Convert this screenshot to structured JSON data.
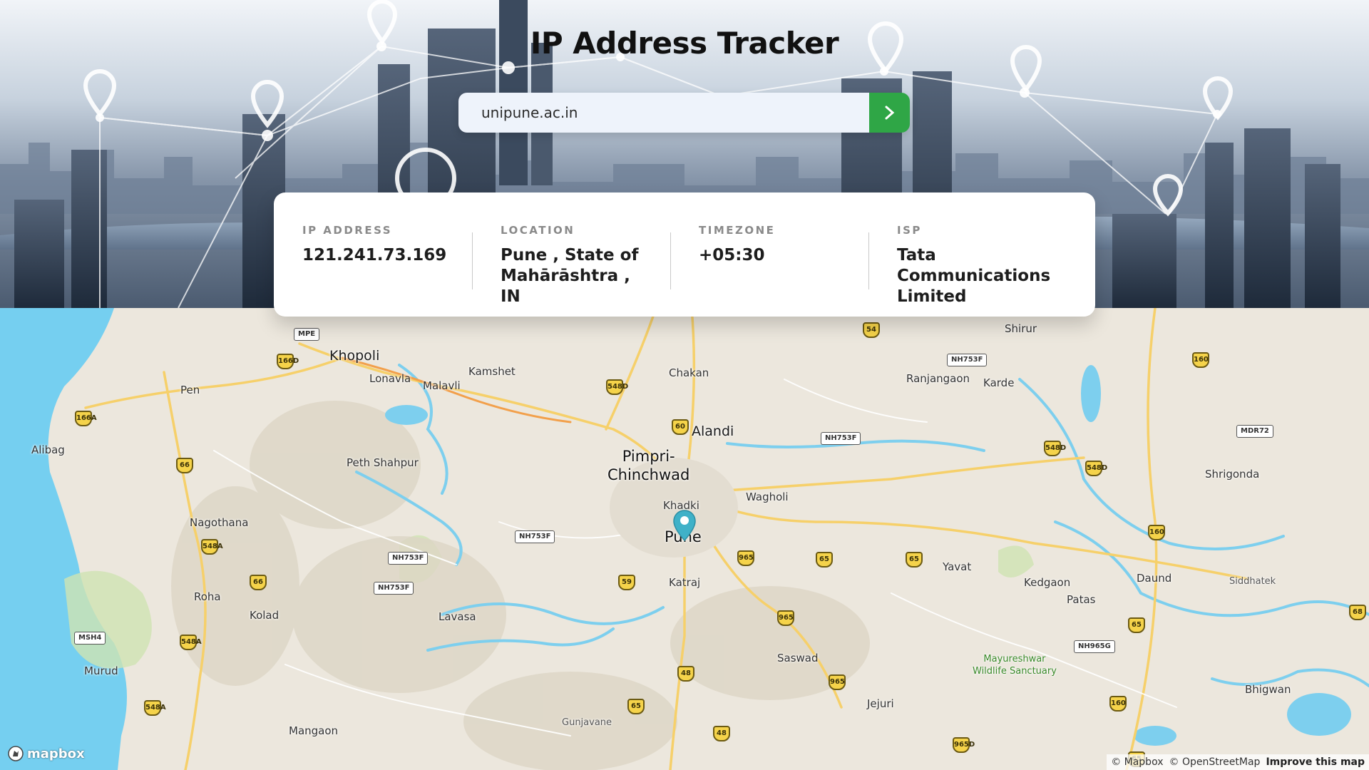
{
  "header": {
    "title": "IP Address Tracker",
    "search": {
      "value": "unipune.ac.in"
    }
  },
  "info": {
    "ip": {
      "label": "IP ADDRESS",
      "value": "121.241.73.169"
    },
    "location": {
      "label": "LOCATION",
      "value": "Pune , State of Mahārāshtra , IN"
    },
    "timezone": {
      "label": "TIMEZONE",
      "value": "+05:30"
    },
    "isp": {
      "label": "ISP",
      "value": "Tata Communications Limited"
    }
  },
  "map": {
    "places": {
      "khopoli": "Khopoli",
      "lonavla": "Lonavla",
      "malavli": "Malavli",
      "kamshet": "Kamshet",
      "pen": "Pen",
      "alibag": "Alibag",
      "peth_shahpur": "Peth Shahpur",
      "nagothana": "Nagothana",
      "roha": "Roha",
      "kolad": "Kolad",
      "murud": "Murud",
      "mangaon": "Mangaon",
      "lavasa": "Lavasa",
      "gunjavane": "Gunjavane",
      "chakan": "Chakan",
      "alandi": "Alandi",
      "pimpri": "Pimpri-",
      "chinchwad": "Chinchwad",
      "khadki": "Khadki",
      "pune": "Pune",
      "wagholi": "Wagholi",
      "katraj": "Katraj",
      "saswad": "Saswad",
      "jejuri": "Jejuri",
      "ranjangaon": "Ranjangaon",
      "karde": "Karde",
      "shirur": "Shirur",
      "shrigonda": "Shrigonda",
      "yavat": "Yavat",
      "kedgaon": "Kedgaon",
      "patas": "Patas",
      "daund": "Daund",
      "siddhatek": "Siddhatek",
      "bhigwan": "Bhigwan",
      "sanctuary1": "Mayureshwar",
      "sanctuary2": "Wildlife Sanctuary"
    },
    "roads": {
      "mpe": "MPE",
      "r166d": "166D",
      "r548d": "548D",
      "r166a": "166A",
      "r66a": "66",
      "r548a": "548A",
      "r66b": "66",
      "msh4": "MSH4",
      "r548a2": "548A",
      "r548a3": "548A",
      "nh753f1": "NH753F",
      "nh753f2": "NH753F",
      "nh753f3": "NH753F",
      "r60": "60",
      "nh753f4": "NH753F",
      "r54": "54",
      "nh753f5": "NH753F",
      "r160a": "160",
      "mdr72": "MDR72",
      "r548d2": "548D",
      "r548d3": "548D",
      "r160b": "160",
      "r965a": "965",
      "r65a": "65",
      "r65b": "65",
      "r59": "59",
      "r965b": "965",
      "r48a": "48",
      "r965c": "965",
      "r65c": "65",
      "r48b": "48",
      "r965d": "965D",
      "r65d": "65",
      "nh965g": "NH965G",
      "r160c": "160",
      "r68": "68",
      "r65e": "65"
    },
    "logo": "mapbox",
    "attribution": {
      "mapbox": "© Mapbox",
      "osm": "© OpenStreetMap",
      "improve": "Improve this map"
    }
  }
}
